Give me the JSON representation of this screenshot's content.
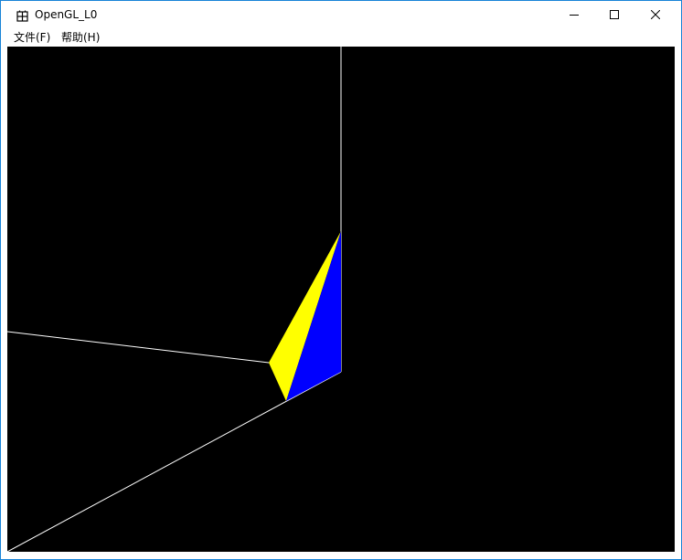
{
  "window": {
    "title": "OpenGL_L0",
    "accent_color": "#1883d7",
    "icon": "window-app-icon"
  },
  "caption_buttons": {
    "minimize_icon": "minimize-icon",
    "maximize_icon": "maximize-icon",
    "close_icon": "close-icon"
  },
  "menu": {
    "items": [
      {
        "label": "文件(F)"
      },
      {
        "label": "帮助(H)"
      }
    ]
  },
  "scene": {
    "background_color": "#000000",
    "axis_color": "#ffffff",
    "face_left_color": "#ffff00",
    "face_right_color": "#0000ff"
  }
}
